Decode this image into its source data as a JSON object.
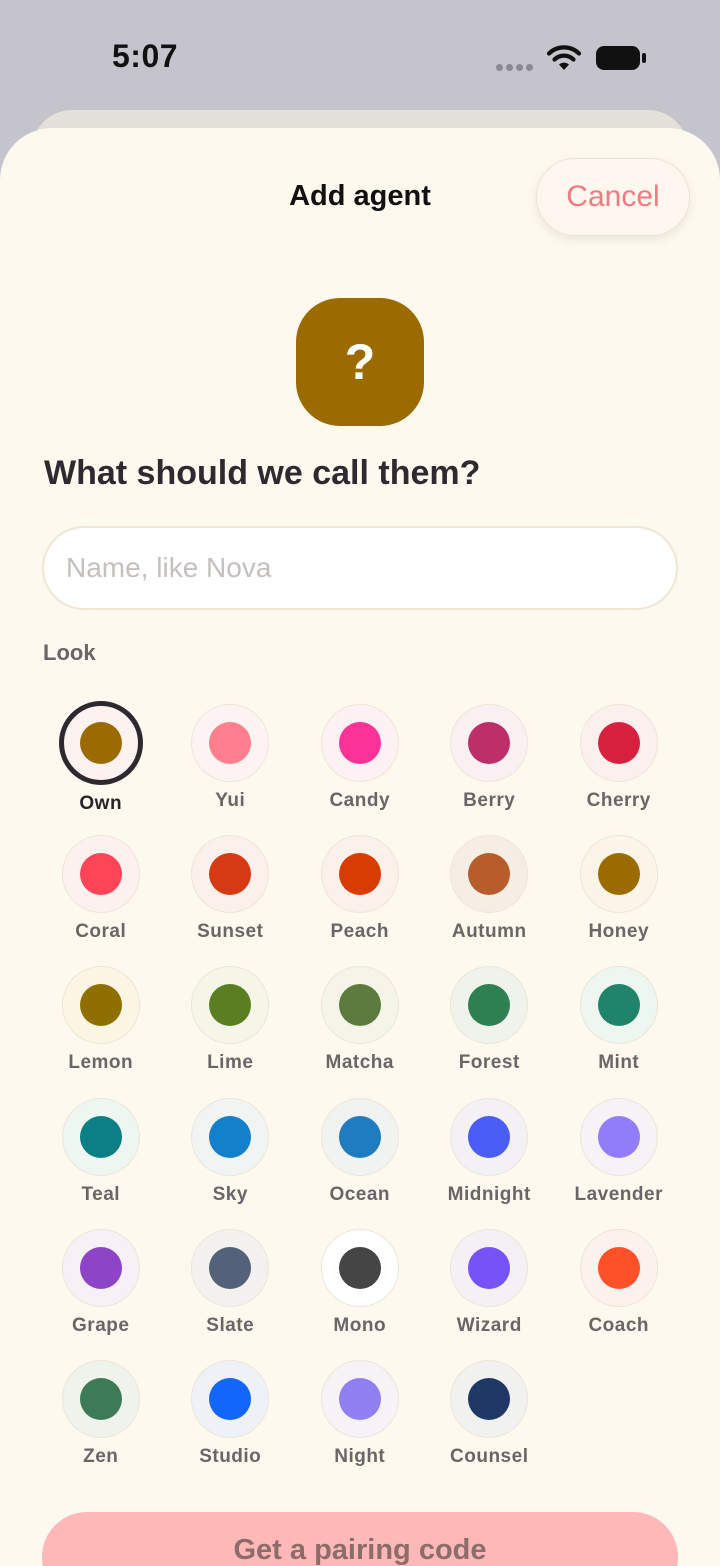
{
  "status": {
    "time": "5:07",
    "icons": [
      "signal-dots-icon",
      "wifi-icon",
      "battery-icon"
    ]
  },
  "header": {
    "title": "Add agent",
    "cancel_label": "Cancel"
  },
  "avatar": {
    "glyph": "?",
    "color": "#9c6b00"
  },
  "form": {
    "heading": "What should we call them?",
    "name_value": "",
    "name_placeholder": "Name, like Nova",
    "look_label": "Look"
  },
  "looks": [
    {
      "label": "Own",
      "color": "#9c6b00",
      "ring": "#fdf2ef",
      "selected": true
    },
    {
      "label": "Yui",
      "color": "#ff7f8e",
      "ring": "#fdf3f2"
    },
    {
      "label": "Candy",
      "color": "#fb3298",
      "ring": "#fdf1f4"
    },
    {
      "label": "Berry",
      "color": "#bd2f69",
      "ring": "#fbf0f1"
    },
    {
      "label": "Cherry",
      "color": "#d8203f",
      "ring": "#fcf0ef"
    },
    {
      "label": "Coral",
      "color": "#ff4458",
      "ring": "#fdf1f0"
    },
    {
      "label": "Sunset",
      "color": "#d63a14",
      "ring": "#fbf0ea"
    },
    {
      "label": "Peach",
      "color": "#d83c00",
      "ring": "#fbf0ea"
    },
    {
      "label": "Autumn",
      "color": "#b75c2b",
      "ring": "#f6eee5"
    },
    {
      "label": "Honey",
      "color": "#9c6b00",
      "ring": "#fbf4e8"
    },
    {
      "label": "Lemon",
      "color": "#8f6f00",
      "ring": "#fbf6e3"
    },
    {
      "label": "Lime",
      "color": "#5a7f21",
      "ring": "#f5f5e8"
    },
    {
      "label": "Matcha",
      "color": "#5d7b3f",
      "ring": "#f4f4e9"
    },
    {
      "label": "Forest",
      "color": "#2e7f52",
      "ring": "#eff3ec"
    },
    {
      "label": "Mint",
      "color": "#1f8469",
      "ring": "#eef6f0"
    },
    {
      "label": "Teal",
      "color": "#0b7f86",
      "ring": "#eef6f2"
    },
    {
      "label": "Sky",
      "color": "#147fca",
      "ring": "#f0f4f3"
    },
    {
      "label": "Ocean",
      "color": "#1e7cbf",
      "ring": "#f1f3f1"
    },
    {
      "label": "Midnight",
      "color": "#4a5df7",
      "ring": "#f3f1f5"
    },
    {
      "label": "Lavender",
      "color": "#917dfa",
      "ring": "#f6f2f5"
    },
    {
      "label": "Grape",
      "color": "#8e44c6",
      "ring": "#f7f0f4"
    },
    {
      "label": "Slate",
      "color": "#53617b",
      "ring": "#f2f1ef"
    },
    {
      "label": "Mono",
      "color": "#454545",
      "ring": "#ffffff"
    },
    {
      "label": "Wizard",
      "color": "#7553f7",
      "ring": "#f4f0f5"
    },
    {
      "label": "Coach",
      "color": "#fe5128",
      "ring": "#fcf1ec"
    },
    {
      "label": "Zen",
      "color": "#3c7b56",
      "ring": "#f0f3ec"
    },
    {
      "label": "Studio",
      "color": "#1266fa",
      "ring": "#eef1f5"
    },
    {
      "label": "Night",
      "color": "#8f7ff0",
      "ring": "#f6f2f5"
    },
    {
      "label": "Counsel",
      "color": "#1f3866",
      "ring": "#f1f1ef"
    }
  ],
  "footer": {
    "pair_label": "Get a pairing code"
  }
}
